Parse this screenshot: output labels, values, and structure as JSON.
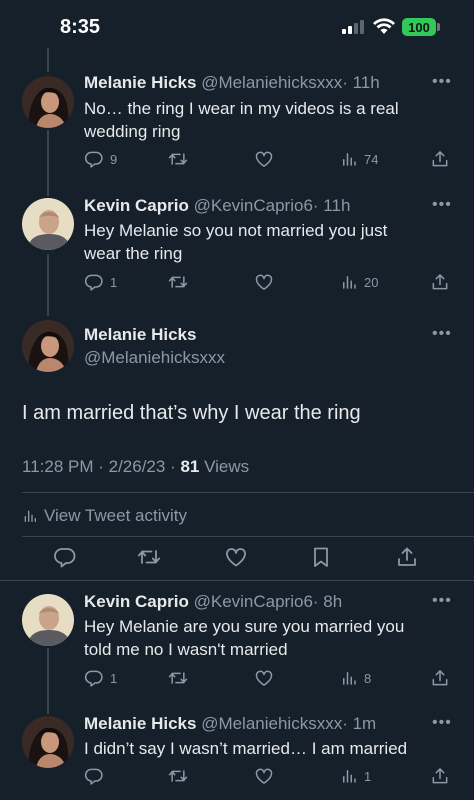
{
  "status_bar": {
    "time": "8:35",
    "battery": "100"
  },
  "tweets": [
    {
      "name": "Melanie Hicks",
      "handle": "@Melaniehicksxxx",
      "time": "· 11h",
      "text": "No… the ring I wear in my videos is a real wedding ring",
      "replies": "9",
      "views": "74"
    },
    {
      "name": "Kevin Caprio",
      "handle": "@KevinCaprio6",
      "time": "· 11h",
      "text": "Hey Melanie so you not married you just wear the ring",
      "replies": "1",
      "views": "20"
    }
  ],
  "focus": {
    "name": "Melanie Hicks",
    "handle": "@Melaniehicksxxx",
    "text": "I am married that’s why I wear the ring",
    "timestamp": "11:28 PM · 2/26/23 · ",
    "views_count": "81",
    "views_label": " Views",
    "activity_label": "View Tweet activity"
  },
  "replies": [
    {
      "name": "Kevin Caprio",
      "handle": "@KevinCaprio6",
      "time": "· 8h",
      "text": "Hey Melanie are you sure you married you told me no I wasn't married",
      "replies": "1",
      "views": "8"
    },
    {
      "name": "Melanie Hicks",
      "handle": "@Melaniehicksxxx",
      "time": "· 1m",
      "text": "I didn’t say I wasn’t married… I am married",
      "replies": "",
      "views": "1"
    }
  ],
  "icons": {
    "reply": "reply-icon",
    "retweet": "retweet-icon",
    "like": "heart-icon",
    "views": "views-icon",
    "share": "share-icon",
    "bookmark": "bookmark-icon",
    "more": "more-icon"
  }
}
